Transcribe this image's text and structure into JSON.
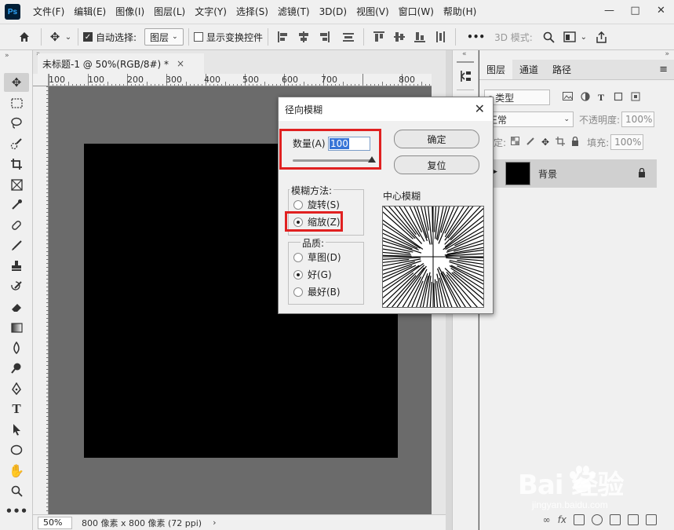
{
  "app": {
    "logo": "Ps",
    "menu": [
      "文件(F)",
      "编辑(E)",
      "图像(I)",
      "图层(L)",
      "文字(Y)",
      "选择(S)",
      "滤镜(T)",
      "3D(D)",
      "视图(V)",
      "窗口(W)",
      "帮助(H)"
    ],
    "window_controls": {
      "minimize": "—",
      "restore": "□",
      "close": "✕"
    }
  },
  "options_bar": {
    "auto_select_label": "自动选择:",
    "auto_select_checked": true,
    "auto_select_target": "图层",
    "show_transform_label": "显示变换控件",
    "show_transform_checked": false,
    "more": "•••",
    "mode_3d": "3D 模式:"
  },
  "document": {
    "tab_title": "未标题-1 @ 50%(RGB/8#) *",
    "tab_close": "×",
    "ruler_labels": [
      "100",
      "100",
      "200",
      "300",
      "400",
      "500",
      "600",
      "700",
      "800"
    ],
    "zoom": "50%",
    "doc_info": "800 像素 x 800 像素 (72 ppi)",
    "status_arrow": "›"
  },
  "layers_panel": {
    "tabs": [
      "图层",
      "通道",
      "路径"
    ],
    "filter_kind": "类型",
    "blend_mode": "正常",
    "opacity_label": "不透明度:",
    "opacity_value": "100%",
    "lock_label": "锁定:",
    "fill_label": "填充:",
    "fill_value": "100%",
    "layer_name": "背景"
  },
  "dialog": {
    "title": "径向模糊",
    "close": "✕",
    "amount_label": "数量(A)",
    "amount_value": "100",
    "amount_level": 1.0,
    "ok_label": "确定",
    "reset_label": "复位",
    "method_label": "模糊方法:",
    "method_options": [
      "旋转(S)",
      "缩放(Z)"
    ],
    "method_selected": "缩放(Z)",
    "quality_label": "品质:",
    "quality_options": [
      "草图(D)",
      "好(G)",
      "最好(B)"
    ],
    "quality_selected": "好(G)",
    "preview_label": "中心模糊"
  },
  "watermark": {
    "brand": "Bai  经验",
    "url": "jingyan.baidu.com"
  },
  "colors": {
    "highlight": "#e02020",
    "selection": "#3875d7",
    "workspace": "#6b6b6b"
  }
}
